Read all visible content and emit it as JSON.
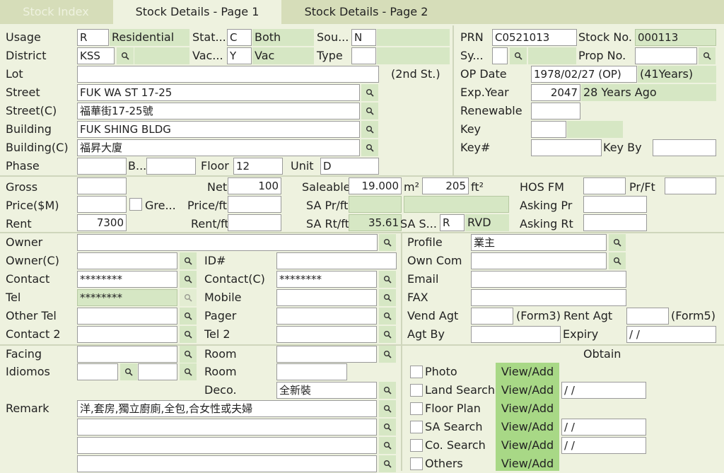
{
  "tabs": [
    "Stock Index",
    "Stock Details - Page 1",
    "Stock Details - Page 2"
  ],
  "top": {
    "usage_label": "Usage",
    "usage": "R",
    "usage_desc": "Residential",
    "status_label": "Stat...",
    "status": "C",
    "status_desc": "Both",
    "source_label": "Sou...",
    "source": "N",
    "district_label": "District",
    "district": "KSS",
    "vacant_label": "Vac...",
    "vacant": "Y",
    "vacant_desc": "Vac",
    "type_label": "Type",
    "type": "",
    "lot_label": "Lot",
    "lot": "",
    "lot_note": "(2nd St.)",
    "street_label": "Street",
    "street": "FUK WA ST 17-25",
    "street_c_label": "Street(C)",
    "street_c": "福華街17-25號",
    "building_label": "Building",
    "building": "FUK SHING BLDG",
    "building_c_label": "Building(C)",
    "building_c": "福昇大廈",
    "phase_label": "Phase",
    "phase": "",
    "b_label": "B...",
    "b": "",
    "floor_label": "Floor",
    "floor": "12",
    "unit_label": "Unit",
    "unit": "D"
  },
  "right_top": {
    "prn_label": "PRN",
    "prn": "C0521013",
    "stock_no_label": "Stock No.",
    "stock_no": "000113",
    "sy_label": "Sy...",
    "sy": "",
    "prop_no_label": "Prop No.",
    "prop_no": "",
    "op_date_label": "OP Date",
    "op_date": "1978/02/27 (OP)",
    "op_years": "(41Years)",
    "exp_year_label": "Exp.Year",
    "exp_year": "2047",
    "exp_note": "28 Years Ago",
    "renewable_label": "Renewable",
    "renewable": "",
    "key_label": "Key",
    "key": "",
    "key_no_label": "Key#",
    "key_no": "",
    "key_by_label": "Key By",
    "key_by": ""
  },
  "area": {
    "gross_label": "Gross",
    "gross": "",
    "net_label": "Net",
    "net": "100",
    "saleable_label": "Saleable",
    "saleable": "19.000",
    "m2_unit": "m²",
    "ft_value": "205",
    "ft2_unit": "ft²",
    "hos_label": "HOS FM",
    "hos": "",
    "prft_label": "Pr/Ft",
    "prft": "",
    "price_label": "Price($M)",
    "price": "",
    "gre_label": "Gre...",
    "price_ft_label": "Price/ft",
    "price_ft": "",
    "sa_prft_label": "SA Pr/ft",
    "sa_prft": "",
    "sa_prft2": "",
    "asking_pr_label": "Asking Pr",
    "asking_pr": "",
    "rent_label": "Rent",
    "rent": "7300",
    "rent_ft_label": "Rent/ft",
    "rent_ft": "",
    "sa_rtft_label": "SA Rt/ft",
    "sa_rtft": "35.61",
    "sa_s_label": "SA S...",
    "sa_s": "R",
    "sa_s_desc": "RVD",
    "asking_rt_label": "Asking Rt",
    "asking_rt": ""
  },
  "owner": {
    "owner_label": "Owner",
    "owner": "",
    "owner_c_label": "Owner(C)",
    "owner_c": "",
    "id_label": "ID#",
    "id": "",
    "contact_label": "Contact",
    "contact": "********",
    "contact_c_label": "Contact(C)",
    "contact_c": "********",
    "tel_label": "Tel",
    "tel": "********",
    "mobile_label": "Mobile",
    "mobile": "",
    "other_tel_label": "Other Tel",
    "other_tel": "",
    "pager_label": "Pager",
    "pager": "",
    "contact2_label": "Contact 2",
    "contact2": "",
    "tel2_label": "Tel 2",
    "tel2": ""
  },
  "owner_right": {
    "profile_label": "Profile",
    "profile": "業主",
    "own_com_label": "Own Com",
    "own_com": "",
    "email_label": "Email",
    "email": "",
    "fax_label": "FAX",
    "fax": "",
    "vend_agt_label": "Vend Agt",
    "vend_agt": "",
    "form3": "(Form3)",
    "rent_agt_label": "Rent Agt",
    "rent_agt": "",
    "form5": "(Form5)",
    "agt_by_label": "Agt By",
    "agt_by": "",
    "expiry_label": "Expiry",
    "expiry": " / /"
  },
  "bottom": {
    "facing_label": "Facing",
    "facing": "",
    "room_label": "Room",
    "room": "",
    "idiomos_label": "Idiomos",
    "idiomos1": "",
    "idiomos2": "",
    "room2_label": "Room",
    "room2": "",
    "deco_label": "Deco.",
    "deco": "全新裝",
    "remark_label": "Remark",
    "remark1": "洋,套房,獨立廚廁,全包,合女性或夫婦",
    "remark2": "",
    "remark3": "",
    "remark4": ""
  },
  "obtain": {
    "title": "Obtain",
    "items": [
      {
        "label": "Photo",
        "button": "View/Add",
        "date": ""
      },
      {
        "label": "Land Search",
        "button": "View/Add",
        "date": " / /"
      },
      {
        "label": "Floor Plan",
        "button": "View/Add",
        "date": ""
      },
      {
        "label": "SA Search",
        "button": "View/Add",
        "date": " / /"
      },
      {
        "label": "Co. Search",
        "button": "View/Add",
        "date": " / /"
      },
      {
        "label": "Others",
        "button": "View/Add",
        "date": ""
      }
    ]
  }
}
